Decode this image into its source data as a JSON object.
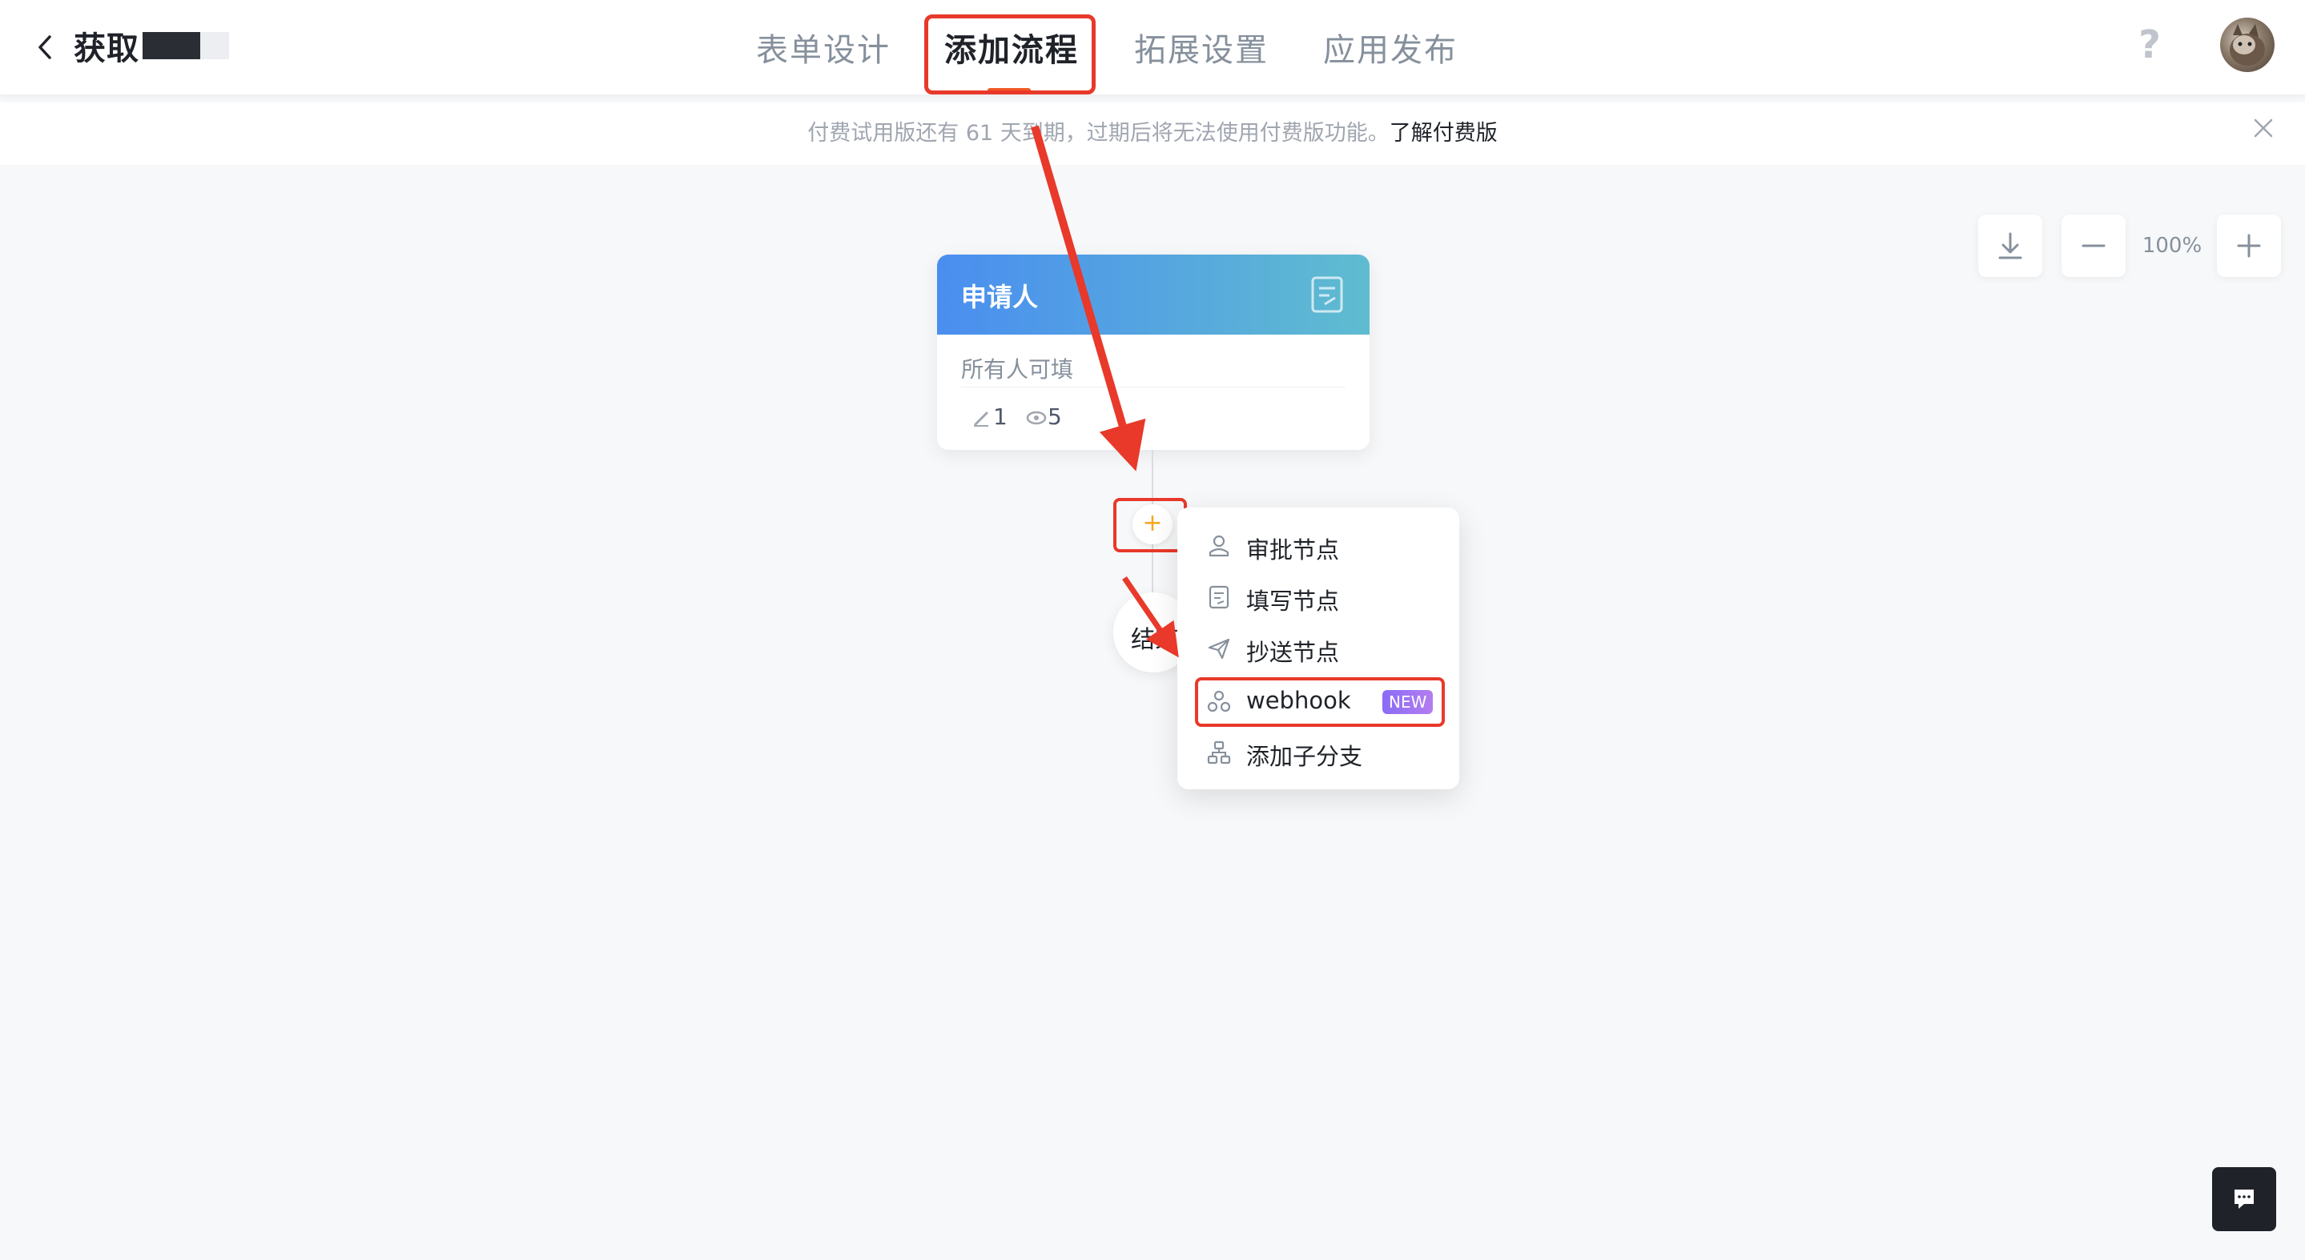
{
  "header": {
    "title": "获取",
    "tabs": [
      {
        "label": "表单设计"
      },
      {
        "label": "添加流程"
      },
      {
        "label": "拓展设置"
      },
      {
        "label": "应用发布"
      }
    ],
    "help_label": "?"
  },
  "banner": {
    "text": "付费试用版还有 61 天到期，过期后将无法使用付费版功能。",
    "link": "了解付费版"
  },
  "zoom": {
    "level": "100%"
  },
  "flow": {
    "node": {
      "title": "申请人",
      "subtitle": "所有人可填",
      "edit_count": "1",
      "view_count": "5"
    },
    "add_button": "+",
    "end_label": "结束"
  },
  "menu": {
    "items": [
      {
        "label": "审批节点",
        "icon": "approver-icon"
      },
      {
        "label": "填写节点",
        "icon": "form-icon"
      },
      {
        "label": "抄送节点",
        "icon": "send-icon"
      },
      {
        "label": "webhook",
        "icon": "webhook-icon",
        "badge": "NEW"
      },
      {
        "label": "添加子分支",
        "icon": "branch-icon"
      }
    ]
  },
  "colors": {
    "accent": "#f15a24",
    "annotation": "#e8392a",
    "node_gradient_start": "#4a8ef0",
    "node_gradient_end": "#5fbcd0",
    "badge": "#9b6cf4"
  }
}
